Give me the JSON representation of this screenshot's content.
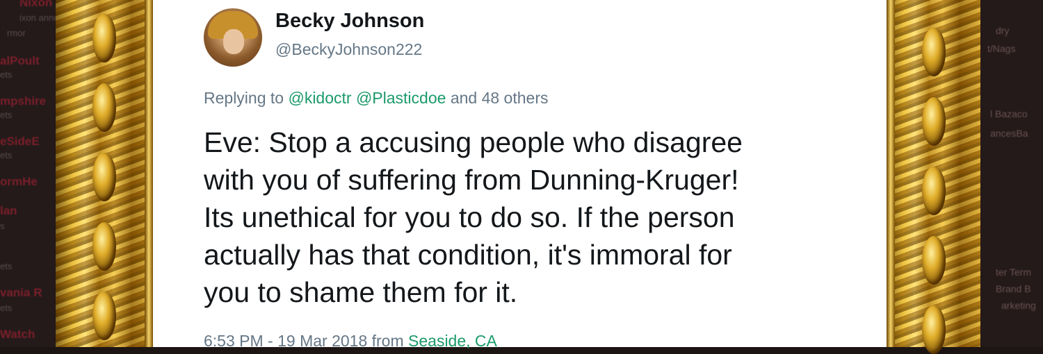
{
  "background_left": {
    "items": [
      {
        "title": "Nixon",
        "sub": "ixon anno"
      },
      {
        "title": "",
        "sub": "rmor"
      },
      {
        "title": "alPoult",
        "sub": "ets"
      },
      {
        "title": "mpshire",
        "sub": "ets"
      },
      {
        "title": "eSideE",
        "sub": "ets"
      },
      {
        "title": "ormHe",
        "sub": ""
      },
      {
        "title": "lan",
        "sub": "s"
      },
      {
        "title": "",
        "sub": "ets"
      },
      {
        "title": "vania R",
        "sub": "ets"
      },
      {
        "title": "Watch",
        "sub": ""
      }
    ]
  },
  "background_right": {
    "items": [
      "dry",
      "t/Nags",
      "l Bazaco",
      "ancesBa",
      "ter Term",
      "Brand B",
      "arketing"
    ]
  },
  "tweet": {
    "author_name": "Becky Johnson",
    "author_handle": "@BeckyJohnson222",
    "replying_prefix": "Replying to",
    "reply_mention_1": "@kidoctr",
    "reply_mention_2": "@Plasticdoe",
    "reply_suffix": "and 48 others",
    "text_lines": [
      "Eve: Stop a accusing people who disagree",
      "with you of suffering from Dunning-Kruger!",
      "Its unethical for you to do so. If the person",
      "actually has that condition, it's immoral for",
      "you to shame them for it."
    ],
    "timestamp": "6:53 PM - 19 Mar 2018 from",
    "location": "Seaside, CA"
  },
  "colors": {
    "link": "#1b9a6a",
    "muted": "#657786",
    "text": "#14171a",
    "frame_gold": "#e8b830"
  },
  "icons": {
    "avatar": "profile-photo"
  }
}
